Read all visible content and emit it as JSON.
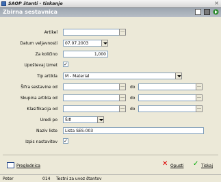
{
  "window": {
    "title": "SAOP štanti - tiskanje",
    "close_glyph": "×"
  },
  "header": {
    "title": "Zbirna sestavnica"
  },
  "form": {
    "artikel_label": "Artikel",
    "datum_label": "Datum veljavnosti",
    "datum_value": "07.07.2003",
    "kolicina_label": "Za količino",
    "kolicina_value": "1,000",
    "upostevaj_label": "Upoštevaj izmet",
    "upostevaj_checked": "✓",
    "tip_label": "Tip artikla",
    "tip_value": "M - Material",
    "sifra_label": "Šifra sestavine od",
    "skupina_label": "Skupina artikla od",
    "klasifikacija_label": "Klasifikacija od",
    "do_label": "do",
    "uredi_label": "Uredi po",
    "uredi_value": "Šifi",
    "naziv_label": "Naziv liste",
    "naziv_value": "Lista SES-003",
    "izpis_label": "Izpis nastavitev",
    "izpis_checked": "✓"
  },
  "actions": {
    "preglednica": "Preglednica",
    "opusti": "Opusti",
    "tiskaj": "Tiskaj"
  },
  "status": {
    "user": "Peter",
    "code": "014",
    "message": "Testni za uvoz štantov"
  }
}
